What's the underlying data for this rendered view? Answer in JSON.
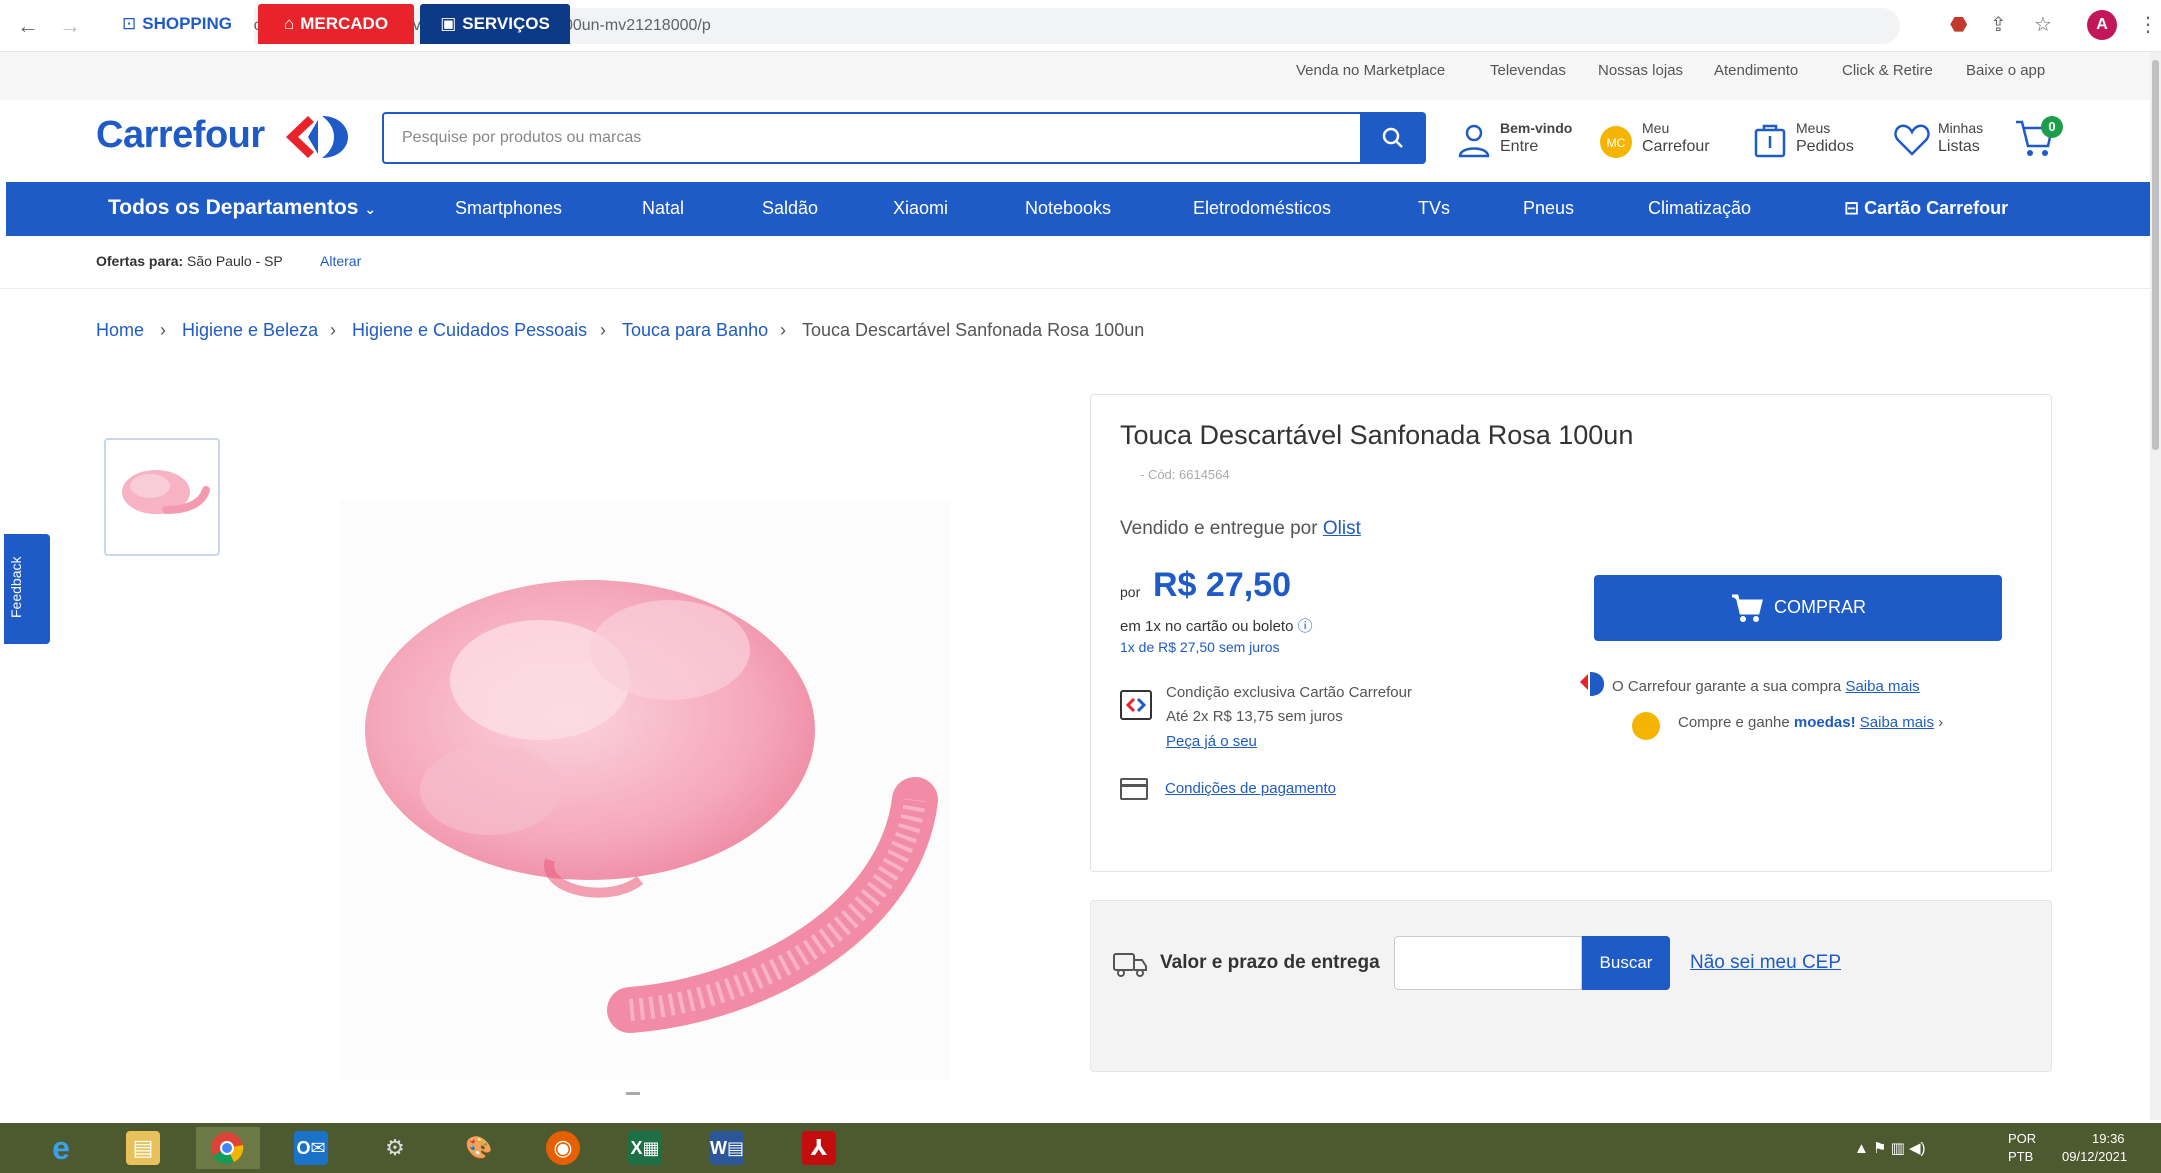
{
  "browser": {
    "url": "carrefour.com.br/touca-descartavel-sanfonada-rosa-100un-mv21218000/p",
    "profile_initial": "A"
  },
  "top_tabs": {
    "shopping": "SHOPPING",
    "mercado": "MERCADO",
    "servicos": "SERVIÇOS"
  },
  "top_links": [
    "Venda no Marketplace",
    "Televendas",
    "Nossas lojas",
    "Atendimento",
    "Click & Retire",
    "Baixe o app"
  ],
  "header": {
    "logo": "Carrefour",
    "search_placeholder": "Pesquise por produtos ou marcas",
    "account_l1": "Bem-vindo",
    "account_l2": "Entre",
    "meu_l1": "Meu",
    "meu_l2": "Carrefour",
    "pedidos_l1": "Meus",
    "pedidos_l2": "Pedidos",
    "listas_l1": "Minhas",
    "listas_l2": "Listas",
    "cart_count": "0"
  },
  "nav": {
    "all": "Todos os Departamentos",
    "items": [
      "Smartphones",
      "Natal",
      "Saldão",
      "Xiaomi",
      "Notebooks",
      "Eletrodomésticos",
      "TVs",
      "Pneus",
      "Climatização"
    ],
    "cartao": "Cartão Carrefour"
  },
  "offers": {
    "label": "Ofertas para:",
    "location": "São Paulo - SP",
    "change": "Alterar"
  },
  "breadcrumb": [
    "Home",
    "Higiene e Beleza",
    "Higiene e Cuidados Pessoais",
    "Touca para Banho",
    "Touca Descartável Sanfonada Rosa 100un"
  ],
  "feedback": "Feedback",
  "product": {
    "title": "Touca Descartável Sanfonada Rosa 100un",
    "code": "- Cód: 6614564",
    "sold_by_prefix": "Vendido e entregue por ",
    "seller": "Olist",
    "price_prefix": "por",
    "price": "R$ 27,50",
    "installments_1": "em 1x no cartão ou boleto",
    "installments_2": "1x de R$ 27,50 sem juros",
    "card_line1": "Condição exclusiva Cartão Carrefour",
    "card_line2": "Até 2x R$ 13,75 sem juros",
    "card_link": "Peça já o seu",
    "payment_link": "Condições de pagamento",
    "buy": "COMPRAR",
    "guarantee": "O Carrefour garante a sua compra ",
    "guarantee_link": "Saiba mais",
    "coins_prefix": "Compre e ganhe ",
    "coins_bold": "moedas!",
    "coins_link": "Saiba mais"
  },
  "shipping": {
    "label": "Valor e prazo de entrega",
    "button": "Buscar",
    "link": "Não sei meu CEP"
  },
  "taskbar": {
    "lang": "POR",
    "lang2": "PTB",
    "time": "19:36",
    "date": "09/12/2021"
  },
  "colors": {
    "brand_blue": "#1e5bc6",
    "mercado_red": "#e8232a",
    "servicos_navy": "#0d3a86",
    "taskbar": "#4d5a2f"
  }
}
